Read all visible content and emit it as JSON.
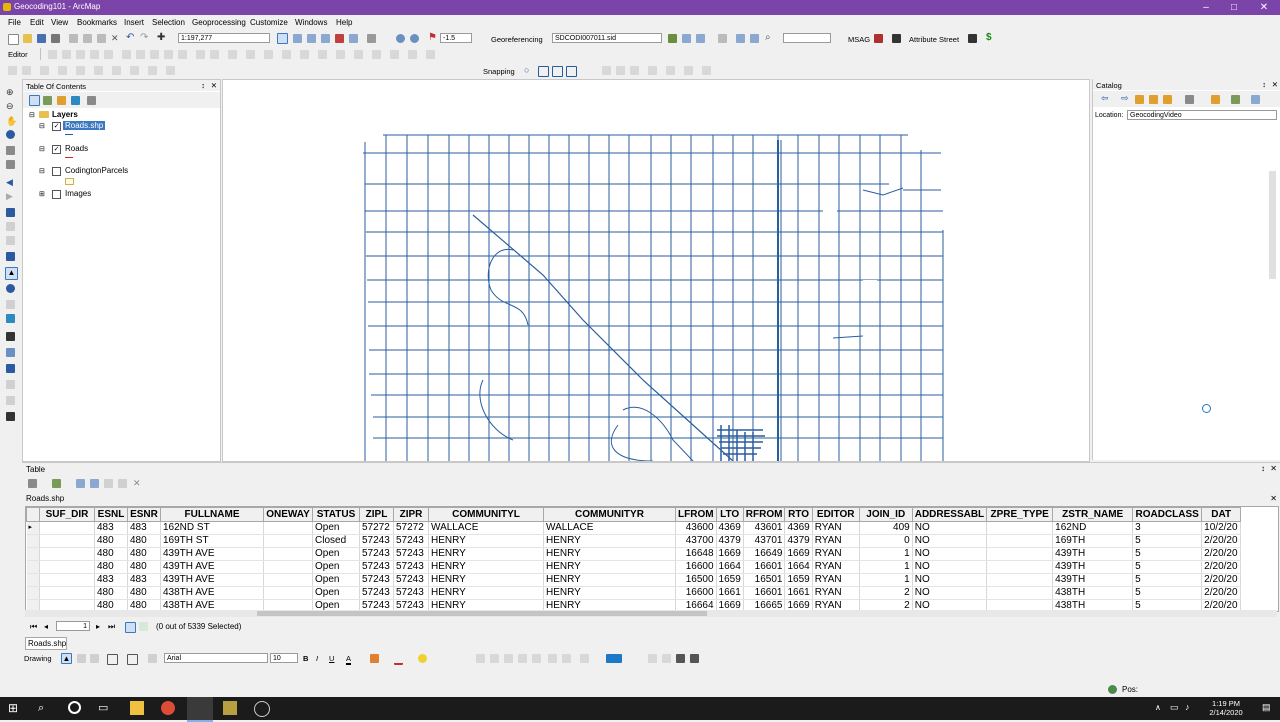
{
  "window": {
    "title": "Geocoding101 - ArcMap"
  },
  "menu": [
    "File",
    "Edit",
    "View",
    "Bookmarks",
    "Insert",
    "Selection",
    "Geoprocessing",
    "Customize",
    "Windows",
    "Help"
  ],
  "toolbar": {
    "scale": "1:197,277",
    "zoom_value": "-1.5",
    "georef_label": "Georeferencing",
    "georef_layer": "SDCODI007011.sid",
    "msag_label": "MSAG",
    "attr_street_label": "Attribute Street",
    "editor_label": "Editor",
    "snapping_label": "Snapping"
  },
  "toc": {
    "title": "Table Of Contents",
    "root": "Layers",
    "layers": [
      {
        "name": "Roads.shp",
        "checked": true,
        "selected": true
      },
      {
        "name": "Roads",
        "checked": true,
        "selected": false
      },
      {
        "name": "CodingtonParcels",
        "checked": false,
        "selected": false
      },
      {
        "name": "Images",
        "checked": false,
        "selected": false
      }
    ]
  },
  "catalog": {
    "title": "Catalog",
    "location_label": "Location:",
    "location_value": "GeocodingVideo"
  },
  "table": {
    "panel_title": "Table",
    "tab_title": "Roads.shp",
    "columns": [
      "SUF_DIR",
      "ESNL",
      "ESNR",
      "FULLNAME",
      "ONEWAY",
      "STATUS",
      "ZIPL",
      "ZIPR",
      "COMMUNITYL",
      "COMMUNITYR",
      "LFROM",
      "LTO",
      "RFROM",
      "RTO",
      "EDITOR",
      "JOIN_ID",
      "ADDRESSABL",
      "ZPRE_TYPE",
      "ZSTR_NAME",
      "ROADCLASS",
      "DAT"
    ],
    "rows": [
      [
        "",
        "483",
        "483",
        "162ND ST",
        "",
        "Open",
        "57272",
        "57272",
        "WALLACE",
        "WALLACE",
        "43600",
        "4369",
        "43601",
        "4369",
        "RYAN",
        "409",
        "NO",
        "",
        "162ND",
        "3",
        "10/2/20"
      ],
      [
        "",
        "480",
        "480",
        "169TH ST",
        "",
        "Closed",
        "57243",
        "57243",
        "HENRY",
        "HENRY",
        "43700",
        "4379",
        "43701",
        "4379",
        "RYAN",
        "0",
        "NO",
        "",
        "169TH",
        "5",
        "2/20/20"
      ],
      [
        "",
        "480",
        "480",
        "439TH AVE",
        "",
        "Open",
        "57243",
        "57243",
        "HENRY",
        "HENRY",
        "16648",
        "1669",
        "16649",
        "1669",
        "RYAN",
        "1",
        "NO",
        "",
        "439TH",
        "5",
        "2/20/20"
      ],
      [
        "",
        "480",
        "480",
        "439TH AVE",
        "",
        "Open",
        "57243",
        "57243",
        "HENRY",
        "HENRY",
        "16600",
        "1664",
        "16601",
        "1664",
        "RYAN",
        "1",
        "NO",
        "",
        "439TH",
        "5",
        "2/20/20"
      ],
      [
        "",
        "483",
        "483",
        "439TH AVE",
        "",
        "Open",
        "57243",
        "57243",
        "HENRY",
        "HENRY",
        "16500",
        "1659",
        "16501",
        "1659",
        "RYAN",
        "1",
        "NO",
        "",
        "439TH",
        "5",
        "2/20/20"
      ],
      [
        "",
        "480",
        "480",
        "438TH AVE",
        "",
        "Open",
        "57243",
        "57243",
        "HENRY",
        "HENRY",
        "16600",
        "1661",
        "16601",
        "1661",
        "RYAN",
        "2",
        "NO",
        "",
        "438TH",
        "5",
        "2/20/20"
      ],
      [
        "",
        "480",
        "480",
        "438TH AVE",
        "",
        "Open",
        "57243",
        "57243",
        "HENRY",
        "HENRY",
        "16664",
        "1669",
        "16665",
        "1669",
        "RYAN",
        "2",
        "NO",
        "",
        "438TH",
        "5",
        "2/20/20"
      ]
    ],
    "record_number": "1",
    "selection_status": "(0 out of 5339 Selected)",
    "bottom_tab": "Roads.shp"
  },
  "drawing": {
    "label": "Drawing",
    "font": "Arial",
    "size": "10"
  },
  "status": {
    "pos_label": "Pos:"
  },
  "taskbar": {
    "time": "1:19 PM",
    "date": "2/14/2020"
  },
  "colors": {
    "titlebar": "#7b44a8",
    "roads": "#2a5d9f",
    "taskbar": "#1b1b1b"
  }
}
